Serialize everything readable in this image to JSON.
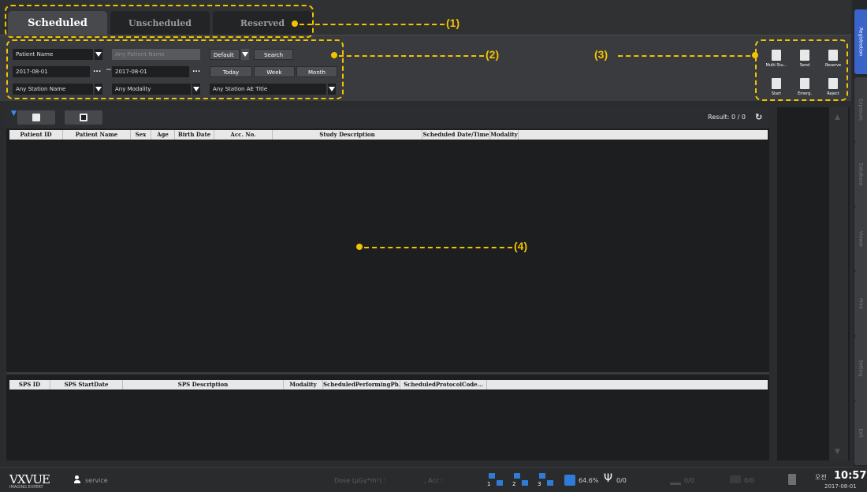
{
  "tabs": [
    {
      "label": "Scheduled",
      "active": true
    },
    {
      "label": "Unscheduled",
      "active": false
    },
    {
      "label": "Reserved",
      "active": false
    }
  ],
  "filter": {
    "field_type": "Patient Name",
    "search_placeholder": "Any Patient Name",
    "preset": "Default",
    "search_button": "Search",
    "date_from": "2017-08-01",
    "date_to": "2017-08-01",
    "range_separator": "~",
    "ellipsis": "...",
    "today_button": "Today",
    "week_button": "Week",
    "month_button": "Month",
    "station_name": "Any Station Name",
    "modality": "Any Modality",
    "station_ae_title": "Any Station AE Title"
  },
  "actions": [
    {
      "label": "Multi Stu...",
      "icon": "multi-study-icon"
    },
    {
      "label": "Send",
      "icon": "send-icon"
    },
    {
      "label": "Reserve",
      "icon": "reserve-icon"
    },
    {
      "label": "Start",
      "icon": "start-patient-icon"
    },
    {
      "label": "Emerg.",
      "icon": "emergency-icon"
    },
    {
      "label": "Reject",
      "icon": "reject-icon"
    }
  ],
  "list": {
    "result_text": "Result: 0 / 0",
    "columns": [
      "Patient ID",
      "Patient Name",
      "Sex",
      "Age",
      "Birth Date",
      "Acc. No.",
      "Study Description",
      "Scheduled Date/Time",
      "Modality"
    ]
  },
  "sps": {
    "columns": [
      "SPS ID",
      "SPS StartDate",
      "SPS Description",
      "Modality",
      "ScheduledPerformingPh...",
      "ScheduledProtocolCode..."
    ]
  },
  "side_tabs": [
    {
      "label": "Registration",
      "active": true
    },
    {
      "label": "Exposure",
      "active": false
    },
    {
      "label": "Database",
      "active": false
    },
    {
      "label": "Viewer",
      "active": false
    },
    {
      "label": "Print",
      "active": false
    },
    {
      "label": "Setting",
      "active": false
    },
    {
      "label": "Exit",
      "active": false
    }
  ],
  "status": {
    "logo_main": "VXVUE",
    "logo_sub": "IMAGING EXPERT",
    "user": "service",
    "dose_label": "Dose (µGy*m²) :",
    "acc_label": ", Acc :",
    "monitors": [
      "1",
      "2",
      "3"
    ],
    "disk_usage": "64.6%",
    "usb_count": "0/0",
    "transfer_count": "0/0",
    "print_count": "0/0",
    "ampm": "오전",
    "time": "10:57",
    "date": "2017-08-01"
  },
  "callouts": [
    "(1)",
    "(2)",
    "(3)",
    "(4)"
  ],
  "colors": {
    "accent": "#3a64c9",
    "annotation": "#f2c300",
    "background": "#2b2c2e"
  }
}
